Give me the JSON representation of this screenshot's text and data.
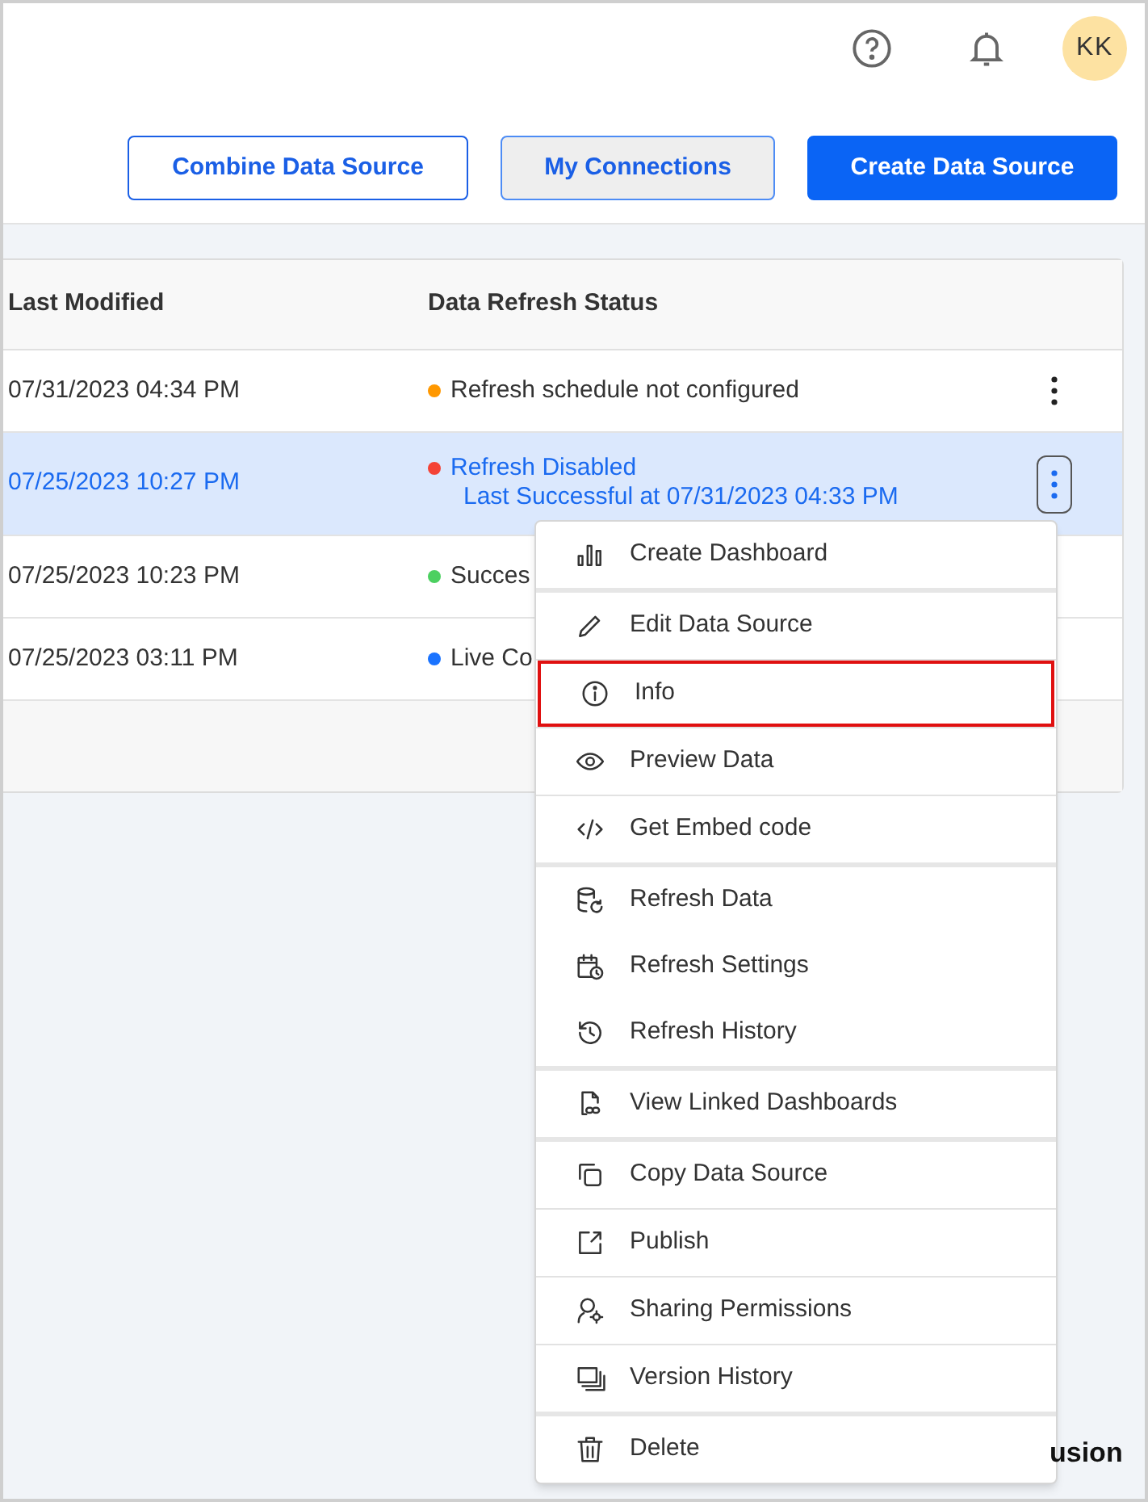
{
  "header": {
    "avatar": "KK"
  },
  "actions": [
    {
      "label": "Combine Data Source",
      "kind": "outline"
    },
    {
      "label": "My Connections",
      "kind": "muted"
    },
    {
      "label": "Create Data Source",
      "kind": "primary"
    }
  ],
  "table": {
    "columns": [
      "Last Modified",
      "Data Refresh Status"
    ],
    "rows": [
      {
        "modified": "07/31/2023 04:34 PM",
        "status": "Refresh schedule not configured",
        "color": "#ff9800",
        "selected": false,
        "menu_button": true
      },
      {
        "modified": "07/25/2023 10:27 PM",
        "status": "Refresh Disabled",
        "detail": "Last Successful at 07/31/2023 04:33 PM",
        "color": "#f44336",
        "selected": true,
        "menu_button": true
      },
      {
        "modified": "07/25/2023 10:23 PM",
        "status": "Succes",
        "color": "#4cd060",
        "selected": false
      },
      {
        "modified": "07/25/2023 03:11 PM",
        "status": "Live Co",
        "color": "#1a73ff",
        "selected": false
      }
    ]
  },
  "menu": {
    "groups": [
      {
        "items": [
          {
            "label": "Create Dashboard",
            "selected": false
          }
        ]
      },
      {
        "separated": true,
        "items": [
          {
            "label": "Edit Data Source",
            "selected": false
          },
          {
            "label": "Info",
            "selected": true
          },
          {
            "label": "Preview Data",
            "selected": false
          },
          {
            "label": "Get Embed code",
            "selected": false
          }
        ]
      },
      {
        "separated": false,
        "items": [
          {
            "label": "Refresh Data",
            "selected": false
          },
          {
            "label": "Refresh Settings",
            "selected": false
          },
          {
            "label": "Refresh History",
            "selected": false
          }
        ]
      },
      {
        "items": [
          {
            "label": "View Linked Dashboards",
            "selected": false
          }
        ]
      },
      {
        "separated": true,
        "items": [
          {
            "label": "Copy Data Source",
            "selected": false
          },
          {
            "label": "Publish",
            "selected": false
          },
          {
            "label": "Sharing Permissions",
            "selected": false
          },
          {
            "label": "Version History",
            "selected": false
          }
        ]
      },
      {
        "items": [
          {
            "label": "Delete",
            "selected": false
          }
        ]
      }
    ]
  },
  "footer": {
    "logo_text": "usion"
  }
}
